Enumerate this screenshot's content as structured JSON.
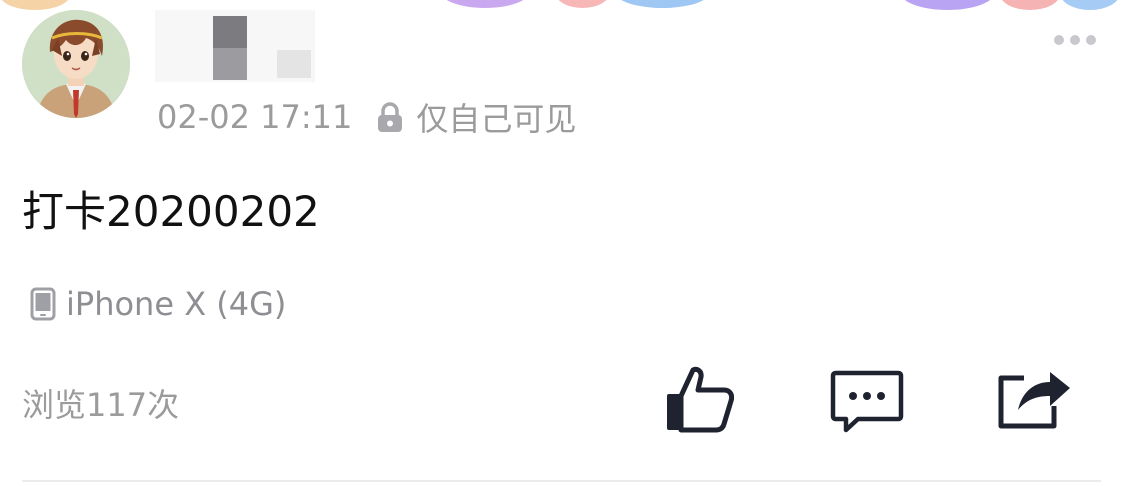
{
  "post": {
    "timestamp": "02-02 17:11",
    "visibility": "仅自己可见",
    "text": "打卡20200202",
    "device": "iPhone X (4G)",
    "views": "浏览117次"
  },
  "icons": {
    "avatar": "avatar-anime-boy",
    "more": "more-dots-icon",
    "lock": "lock-icon",
    "device": "phone-icon",
    "like": "thumbs-up-icon",
    "comment": "comment-bubble-icon",
    "share": "share-arrow-icon"
  },
  "colors": {
    "meta_text": "#9b9b9b",
    "body_text": "#111111",
    "icon_dark": "#1f2330",
    "icon_muted": "#c8c9cc"
  }
}
